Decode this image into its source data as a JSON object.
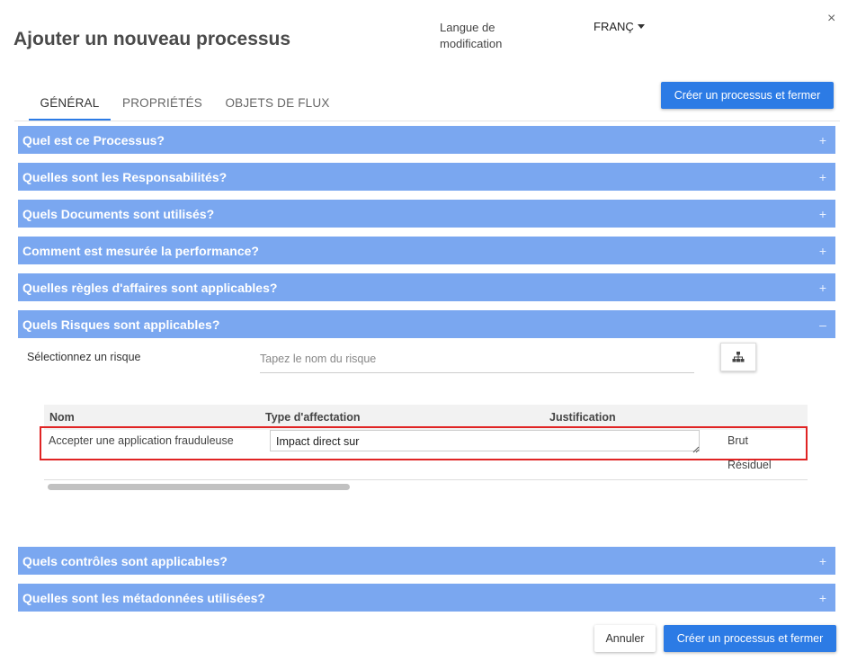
{
  "dialog": {
    "title": "Ajouter un nouveau processus",
    "language_label": "Langue de modification",
    "language_value": "FRANÇ",
    "close_icon": "×"
  },
  "top_button_label": "Créer un processus et fermer",
  "tabs": [
    {
      "label": "GÉNÉRAL",
      "active": true
    },
    {
      "label": "PROPRIÉTÉS",
      "active": false
    },
    {
      "label": "OBJETS DE FLUX",
      "active": false
    }
  ],
  "sections": [
    {
      "title": "Quel est ce Processus?",
      "icon": "+"
    },
    {
      "title": "Quelles sont les Responsabilités?",
      "icon": "+"
    },
    {
      "title": "Quels Documents sont utilisés?",
      "icon": "+"
    },
    {
      "title": "Comment est mesurée la performance?",
      "icon": "+"
    },
    {
      "title": "Quelles règles d'affaires sont applicables?",
      "icon": "+"
    },
    {
      "title": "Quels Risques sont applicables?",
      "icon": "–"
    },
    {
      "title": "Quels contrôles sont applicables?",
      "icon": "+"
    },
    {
      "title": "Quelles sont les métadonnées utilisées?",
      "icon": "+"
    }
  ],
  "risk_panel": {
    "select_label": "Sélectionnez un risque",
    "search_placeholder": "Tapez le nom du risque",
    "table": {
      "headers": {
        "name": "Nom",
        "type": "Type d'affectation",
        "justification": "Justification"
      },
      "row": {
        "name": "Accepter une application frauduleuse",
        "justification_value": "Impact direct sur",
        "level_1": "Brut",
        "level_2": "Résiduel"
      }
    }
  },
  "footer": {
    "cancel_label": "Annuler",
    "submit_label": "Créer un processus et fermer"
  },
  "colors": {
    "accent": "#2c7be5",
    "section_header": "#7aa7f0",
    "highlight_border": "#e02424"
  }
}
